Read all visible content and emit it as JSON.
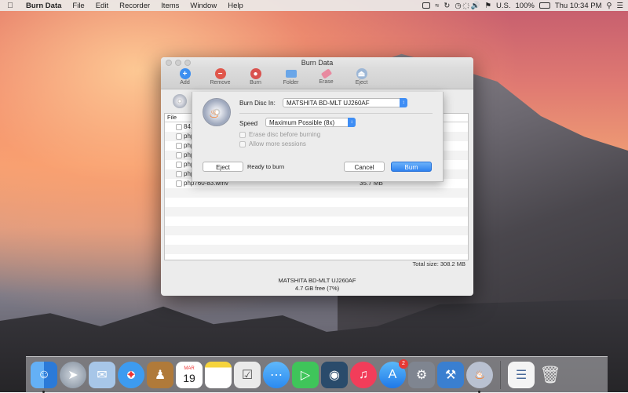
{
  "menubar": {
    "app": "Burn Data",
    "items": [
      "File",
      "Edit",
      "Recorder",
      "Items",
      "Window",
      "Help"
    ],
    "input_source": "U.S.",
    "battery": "100%",
    "clock": "Thu 10:34 PM"
  },
  "window": {
    "title": "Burn Data",
    "toolbar": [
      "Add",
      "Remove",
      "Burn",
      "Folder",
      "Erase",
      "Eject"
    ],
    "list_header": "File",
    "files": [
      {
        "name": "84...",
        "size": ""
      },
      {
        "name": "php...",
        "size": ""
      },
      {
        "name": "php...",
        "size": ""
      },
      {
        "name": "php...",
        "size": ""
      },
      {
        "name": "php...",
        "size": ""
      },
      {
        "name": "php...",
        "size": ""
      },
      {
        "name": "php760-83.wmv",
        "size": "35.7 MB"
      }
    ],
    "total_size": "Total size: 308.2 MB",
    "drive_name": "MATSHITA BD-MLT UJ260AF",
    "drive_free": "4.7 GB free (7%)"
  },
  "sheet": {
    "burn_disc_in_label": "Burn Disc In:",
    "burn_disc_in_value": "MATSHITA BD-MLT UJ260AF",
    "speed_label": "Speed",
    "speed_value": "Maximum Possible (8x)",
    "erase_label": "Erase disc before burning",
    "sessions_label": "Allow more sessions",
    "eject_label": "Eject",
    "status": "Ready to burn",
    "cancel_label": "Cancel",
    "burn_label": "Burn"
  },
  "dock": {
    "calendar_month": "MAR",
    "calendar_day": "19",
    "appstore_badge": "2"
  }
}
